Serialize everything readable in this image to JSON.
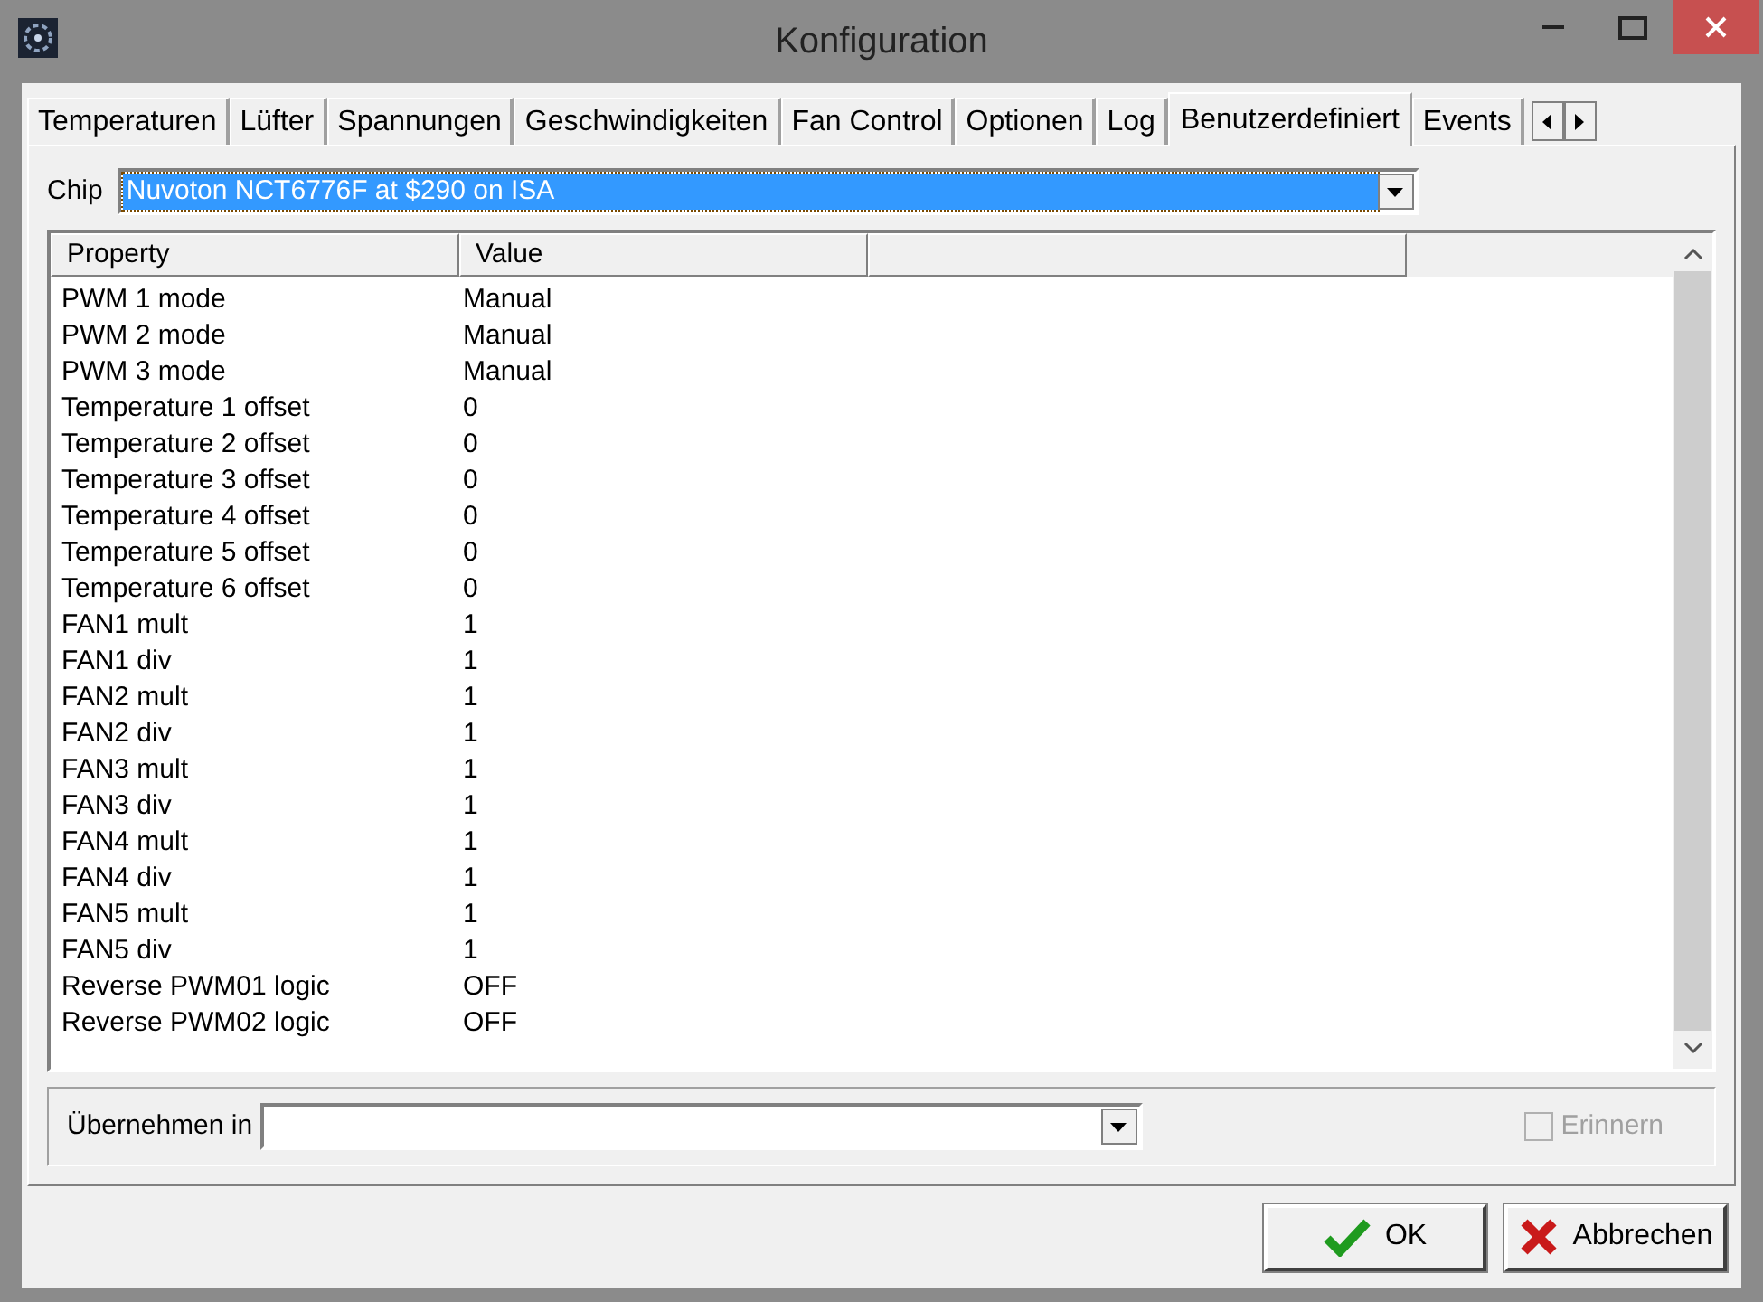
{
  "window": {
    "title": "Konfiguration"
  },
  "tabs": [
    {
      "label": "Temperaturen",
      "selected": false
    },
    {
      "label": "Lüfter",
      "selected": false
    },
    {
      "label": "Spannungen",
      "selected": false
    },
    {
      "label": "Geschwindigkeiten",
      "selected": false
    },
    {
      "label": "Fan Control",
      "selected": false
    },
    {
      "label": "Optionen",
      "selected": false
    },
    {
      "label": "Log",
      "selected": false
    },
    {
      "label": "Benutzerdefiniert",
      "selected": true
    },
    {
      "label": "Events",
      "selected": false
    }
  ],
  "chip": {
    "label": "Chip",
    "value": "Nuvoton NCT6776F at $290 on ISA"
  },
  "table": {
    "columns": [
      "Property",
      "Value"
    ],
    "rows": [
      [
        "PWM 1 mode",
        "Manual"
      ],
      [
        "PWM 2 mode",
        "Manual"
      ],
      [
        "PWM 3 mode",
        "Manual"
      ],
      [
        "Temperature 1 offset",
        "0"
      ],
      [
        "Temperature 2 offset",
        "0"
      ],
      [
        "Temperature 3 offset",
        "0"
      ],
      [
        "Temperature 4 offset",
        "0"
      ],
      [
        "Temperature 5 offset",
        "0"
      ],
      [
        "Temperature 6 offset",
        "0"
      ],
      [
        "FAN1 mult",
        "1"
      ],
      [
        "FAN1 div",
        "1"
      ],
      [
        "FAN2 mult",
        "1"
      ],
      [
        "FAN2 div",
        "1"
      ],
      [
        "FAN3 mult",
        "1"
      ],
      [
        "FAN3 div",
        "1"
      ],
      [
        "FAN4 mult",
        "1"
      ],
      [
        "FAN4 div",
        "1"
      ],
      [
        "FAN5 mult",
        "1"
      ],
      [
        "FAN5 div",
        "1"
      ],
      [
        "Reverse PWM01 logic",
        "OFF"
      ],
      [
        "Reverse PWM02 logic",
        "OFF"
      ]
    ]
  },
  "apply": {
    "label": "Übernehmen in"
  },
  "remember": {
    "label": "Erinnern",
    "checked": false,
    "disabled": true
  },
  "buttons": [
    {
      "label": "OK",
      "kind": "ok"
    },
    {
      "label": "Abbrechen",
      "kind": "cancel"
    }
  ]
}
